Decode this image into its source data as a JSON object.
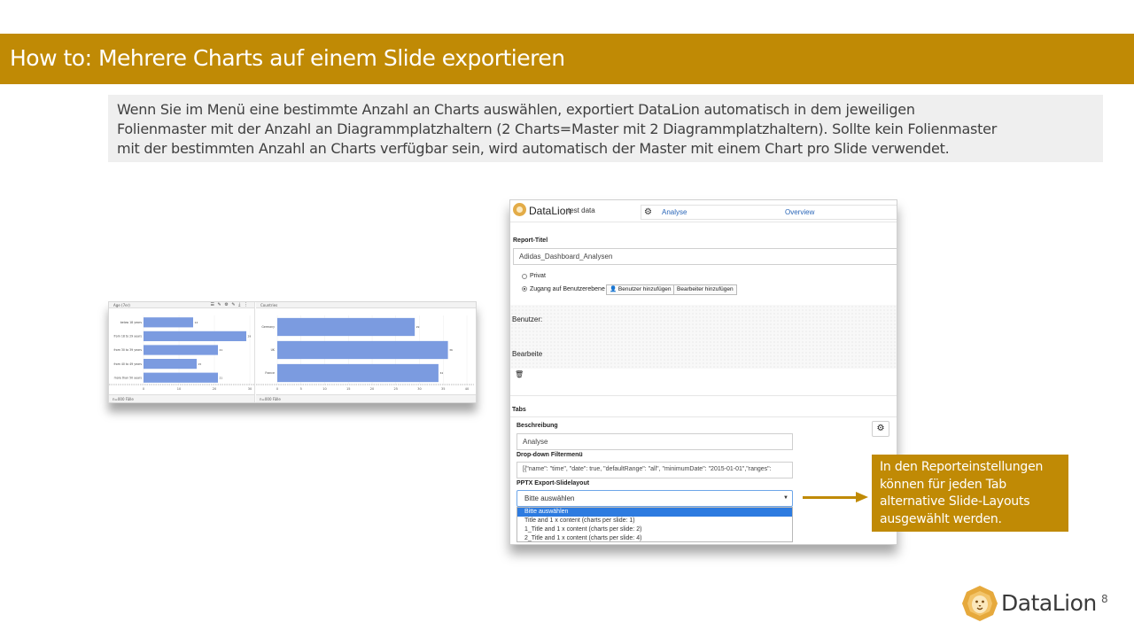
{
  "slide": {
    "title": "How to: Mehrere Charts auf einem Slide exportieren",
    "info_lines": [
      "Wenn Sie im Menü eine bestimmte Anzahl an Charts auswählen, exportiert DataLion automatisch in dem jeweiligen",
      "Folienmaster mit der Anzahl an Diagrammplatzhaltern (2 Charts=Master mit 2 Diagrammplatzhaltern). Sollte kein Folienmaster",
      "mit der bestimmten Anzahl an Charts verfügbar sein, wird automatisch der Master mit einem Chart pro Slide verwendet."
    ],
    "callout_lines": [
      "In den Reporteinstellungen",
      "können für jeden Tab",
      "alternative Slide-Layouts",
      "ausgewählt werden."
    ],
    "footer_brand": "DataLion",
    "page_number": "8",
    "accent_color": "#c08a05"
  },
  "charts_screenshot": {
    "left_panel": {
      "header": "Age (7er)",
      "footer": "n=000 Fälle",
      "tools": "☰ ✎ ⚙ ✎ ⤓ ⋮"
    },
    "right_panel": {
      "header": "Countries",
      "footer": "n=000 Fälle"
    }
  },
  "chart_data": [
    {
      "type": "bar",
      "orientation": "horizontal",
      "title": "Age (7er)",
      "categories": [
        "below 18 years",
        "from 18 to 29 years",
        "from 30 to 39 years",
        "from 40 to 49 years",
        "more than 50 years"
      ],
      "values": [
        14,
        29,
        21,
        15,
        21
      ],
      "xlim": [
        0,
        30
      ],
      "xticks": [
        0,
        10,
        20,
        30
      ],
      "color": "#7b9be0"
    },
    {
      "type": "bar",
      "orientation": "horizontal",
      "title": "Countries",
      "categories": [
        "Germany",
        "UK",
        "France"
      ],
      "values": [
        29,
        36,
        34
      ],
      "xlim": [
        0,
        40
      ],
      "xticks": [
        0,
        5,
        10,
        15,
        20,
        25,
        30,
        35,
        40
      ],
      "color": "#7b9be0"
    }
  ],
  "app": {
    "brand": "DataLion",
    "brand_sub": "test data",
    "tab_analyse": "Analyse",
    "tab_overview": "Overview",
    "report_title_label": "Report-Titel",
    "report_title_value": "Adidas_Dashboard_Analysen",
    "radio_private": "Privat",
    "radio_user_access": "Zugang auf Benutzerebene",
    "btn_add_user": "Benutzer hinzufügen",
    "btn_add_editor": "Bearbeiter hinzufügen",
    "users_label": "Benutzer:",
    "editors_label": "Bearbeite",
    "tabs_label": "Tabs",
    "description_label": "Beschreibung",
    "description_value": "Analyse",
    "dropdown_filter_label": "Drop-down Filtermenü",
    "dropdown_filter_value": "[{\"name\": \"time\", \"date\": true, \"defaultRange\": \"all\", \"minimumDate\": \"2015-01-01\",\"ranges\":",
    "pptx_label": "PPTX Export-Slidelayout",
    "pptx_selected": "Bitte auswählen",
    "pptx_options": [
      "Bitte auswählen",
      "Title and 1 x content (charts per slide: 1)",
      "1_Title and 1 x content (charts per slide: 2)",
      "2_Title and 1 x content (charts per slide: 4)"
    ]
  }
}
